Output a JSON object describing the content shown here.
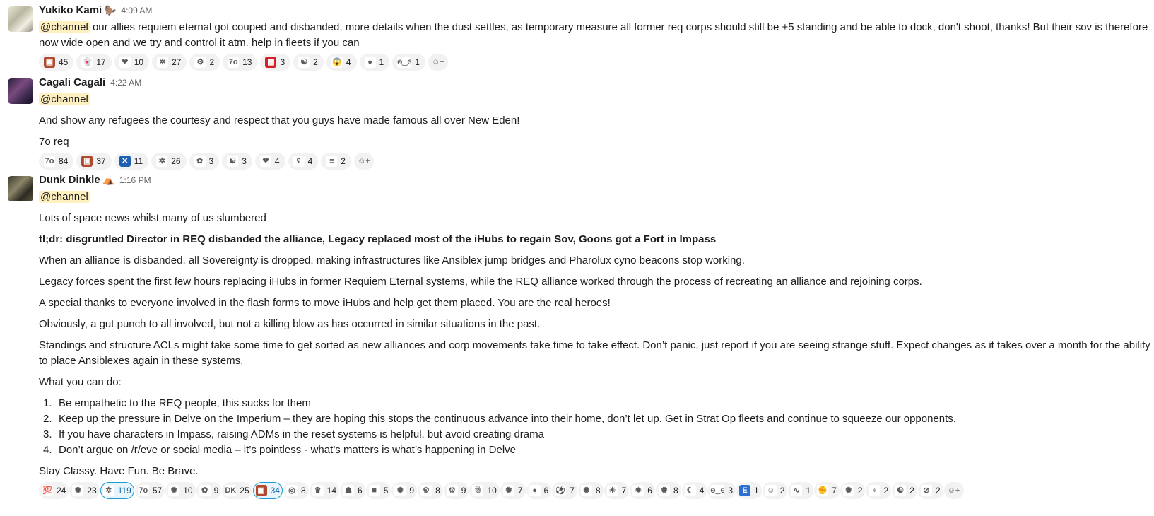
{
  "messages": [
    {
      "author": "Yukiko Kami",
      "status_emoji": "🦫",
      "time": "4:09 AM",
      "mention": "@channel",
      "text": " our allies requiem eternal got couped and disbanded, more details when the dust settles, as temporary measure all former req corps should still be +5 standing and be able to dock, don't shoot, thanks! But their sov is therefore now wide open and we try and control it atm. help in fleets if you can",
      "reactions": [
        {
          "icon": "req-logo-icon",
          "glyph": "▣",
          "color": "#b04a2e",
          "count": "45"
        },
        {
          "icon": "ghost-icon",
          "glyph": "👻",
          "color": "#ffffff",
          "count": "17"
        },
        {
          "icon": "heart-icon",
          "glyph": "❤",
          "color": "#ffffff",
          "count": "10"
        },
        {
          "icon": "butterfly-icon",
          "glyph": "✲",
          "color": "#ffffff",
          "count": "27"
        },
        {
          "icon": "gear-badge-icon",
          "glyph": "⚙",
          "color": "#ffffff",
          "count": "2"
        },
        {
          "icon": "seven-o-icon",
          "glyph": "7o",
          "color": "#ffffff",
          "count": "13"
        },
        {
          "icon": "red-square-icon",
          "glyph": "▦",
          "color": "#d4202a",
          "count": "3"
        },
        {
          "icon": "korea-flag-icon",
          "glyph": "☯",
          "color": "#ffffff",
          "count": "2"
        },
        {
          "icon": "scream-face-icon",
          "glyph": "😱",
          "color": "#ffffff",
          "count": "4"
        },
        {
          "icon": "dark-sphere-icon",
          "glyph": "●",
          "color": "#ffffff",
          "count": "1"
        },
        {
          "icon": "ascii-face-icon",
          "glyph": "ʘ‿ʘ",
          "color": "#ffffff",
          "count": "1"
        }
      ]
    },
    {
      "author": "Cagali Cagali",
      "time": "4:22 AM",
      "mention": "@channel",
      "paragraphs": [
        "And show any refugees the courtesy and respect that you guys have made famous all over New Eden!",
        "7o req"
      ],
      "reactions": [
        {
          "icon": "seven-o-icon",
          "glyph": "7o",
          "color": "#ffffff",
          "count": "84"
        },
        {
          "icon": "req-logo-icon",
          "glyph": "▣",
          "color": "#b04a2e",
          "count": "37"
        },
        {
          "icon": "scotland-flag-icon",
          "glyph": "✕",
          "color": "#1f5fb0",
          "count": "11"
        },
        {
          "icon": "butterfly-icon",
          "glyph": "✲",
          "color": "#ffffff",
          "count": "26"
        },
        {
          "icon": "sunflower-icon",
          "glyph": "✿",
          "color": "#ffffff",
          "count": "3"
        },
        {
          "icon": "korea-flag-icon",
          "glyph": "☯",
          "color": "#ffffff",
          "count": "3"
        },
        {
          "icon": "heart-icon",
          "glyph": "❤",
          "color": "#ffffff",
          "count": "4"
        },
        {
          "icon": "bear-icon",
          "glyph": "ʕ",
          "color": "#ffffff",
          "count": "4"
        },
        {
          "icon": "netherlands-flag-icon",
          "glyph": "≡",
          "color": "#ffffff",
          "count": "2"
        }
      ]
    },
    {
      "author": "Dunk Dinkle",
      "status_emoji": "⛺",
      "time": "1:16 PM",
      "mention": "@channel",
      "paragraphs": [
        "Lots of space news whilst many of us slumbered",
        "tl;dr: disgruntled Director in REQ disbanded the alliance, Legacy replaced most of the iHubs to regain Sov, Goons got a Fort in Impass",
        "When an alliance is disbanded, all Sovereignty is dropped, making infrastructures like Ansiblex jump bridges and Pharolux cyno beacons stop working.",
        "Legacy forces spent the first few hours replacing iHubs in former Requiem Eternal systems, while the REQ alliance worked through the process of recreating an alliance and rejoining corps.",
        "A special thanks to everyone involved in the flash forms to move iHubs and help get them placed. You are the real heroes!",
        "Obviously, a gut punch to all involved, but not a killing blow as has occurred in similar situations in the past.",
        "Standings and structure ACLs might take some time to get sorted as new alliances and corp movements take time to take effect. Don’t panic, just report if you are seeing strange stuff. Expect changes as it takes over a month for the ability to place Ansiblexes again in these systems.",
        "What you can do:"
      ],
      "steps": [
        {
          "num": "1.",
          "text": "Be empathetic to the REQ people, this sucks for them"
        },
        {
          "num": "2.",
          "text": "Keep up the pressure in Delve on the Imperium – they are hoping this stops the continuous advance into their home, don’t let up. Get in Strat Op fleets and continue to squeeze our opponents."
        },
        {
          "num": "3.",
          "text": "If you have characters in Impass, raising ADMs in the reset systems is helpful, but avoid creating drama"
        },
        {
          "num": "4.",
          "text": "Don’t argue on /r/eve or social media – it’s pointless - what’s matters is what’s happening in Delve"
        }
      ],
      "closing": "Stay Classy. Have Fun. Be Brave.",
      "reactions": [
        {
          "icon": "hundred-icon",
          "glyph": "💯",
          "color": "#ffffff",
          "count": "24"
        },
        {
          "icon": "alliance-logo-icon",
          "glyph": "✺",
          "color": "#ffffff",
          "count": "23"
        },
        {
          "icon": "butterfly-icon",
          "glyph": "✲",
          "color": "#ffffff",
          "count": "119",
          "mine": true
        },
        {
          "icon": "seven-o-icon",
          "glyph": "7o",
          "color": "#ffffff",
          "count": "57"
        },
        {
          "icon": "alliance-logo-icon",
          "glyph": "✺",
          "color": "#ffffff",
          "count": "10"
        },
        {
          "icon": "sunflower-icon",
          "glyph": "✿",
          "color": "#ffffff",
          "count": "9"
        },
        {
          "icon": "dunk-text-icon",
          "glyph": "DK",
          "color": "#ffffff",
          "count": "25"
        },
        {
          "icon": "req-logo-icon",
          "glyph": "▣",
          "color": "#b04a2e",
          "count": "34",
          "mine": true
        },
        {
          "icon": "target-icon",
          "glyph": "◎",
          "color": "#ffffff",
          "count": "8"
        },
        {
          "icon": "crown-icon",
          "glyph": "♛",
          "color": "#ffffff",
          "count": "14"
        },
        {
          "icon": "frog-icon",
          "glyph": "☗",
          "color": "#ffffff",
          "count": "6"
        },
        {
          "icon": "black-square-icon",
          "glyph": "■",
          "color": "#ffffff",
          "count": "5"
        },
        {
          "icon": "alliance-logo-icon",
          "glyph": "✺",
          "color": "#ffffff",
          "count": "9"
        },
        {
          "icon": "gear-badge-icon",
          "glyph": "⚙",
          "color": "#ffffff",
          "count": "8"
        },
        {
          "icon": "gear-badge-icon",
          "glyph": "⚙",
          "color": "#ffffff",
          "count": "9"
        },
        {
          "icon": "santa-icon",
          "glyph": "☃",
          "color": "#ffffff",
          "count": "10"
        },
        {
          "icon": "alliance-logo-icon",
          "glyph": "✺",
          "color": "#ffffff",
          "count": "7"
        },
        {
          "icon": "cookie-icon",
          "glyph": "●",
          "color": "#ffffff",
          "count": "6"
        },
        {
          "icon": "soccer-ball-icon",
          "glyph": "⚽",
          "color": "#ffffff",
          "count": "7"
        },
        {
          "icon": "alliance-logo-icon",
          "glyph": "✺",
          "color": "#ffffff",
          "count": "8"
        },
        {
          "icon": "sun-badge-icon",
          "glyph": "☀",
          "color": "#ffffff",
          "count": "7"
        },
        {
          "icon": "red-badge-icon",
          "glyph": "✹",
          "color": "#ffffff",
          "count": "6"
        },
        {
          "icon": "alliance-logo-icon",
          "glyph": "✺",
          "color": "#ffffff",
          "count": "8"
        },
        {
          "icon": "dark-moon-icon",
          "glyph": "☾",
          "color": "#ffffff",
          "count": "4"
        },
        {
          "icon": "ascii-face-icon",
          "glyph": "ʘ‿ʘ",
          "color": "#ffffff",
          "count": "3"
        },
        {
          "icon": "letter-e-icon",
          "glyph": "E",
          "color": "#2a6fd1",
          "count": "1"
        },
        {
          "icon": "pixel-face-icon",
          "glyph": "☺",
          "color": "#ffffff",
          "count": "2"
        },
        {
          "icon": "caterpillar-icon",
          "glyph": "∿",
          "color": "#ffffff",
          "count": "1"
        },
        {
          "icon": "flex-arm-icon",
          "glyph": "✊",
          "color": "#ffffff",
          "count": "7"
        },
        {
          "icon": "alliance-logo-icon",
          "glyph": "✺",
          "color": "#ffffff",
          "count": "2"
        },
        {
          "icon": "cactus-icon",
          "glyph": "♆",
          "color": "#ffffff",
          "count": "2"
        },
        {
          "icon": "korea-flag-icon",
          "glyph": "☯",
          "color": "#ffffff",
          "count": "2"
        },
        {
          "icon": "no-entry-icon",
          "glyph": "⊘",
          "color": "#ffffff",
          "count": "2"
        }
      ]
    }
  ],
  "add_reaction_glyph": "☺+"
}
